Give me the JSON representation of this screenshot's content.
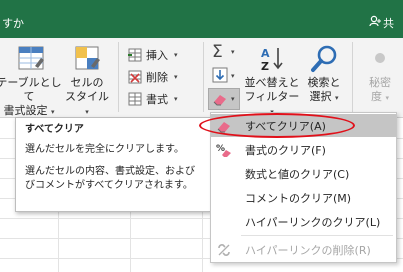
{
  "window": {
    "title_fragment": "すか",
    "share_label": "共"
  },
  "ribbon": {
    "table_button": {
      "line1": "テーブルとして",
      "line2": "書式設定"
    },
    "cell_style_button": {
      "line1": "セルの",
      "line2": "スタイル"
    },
    "cells_group": {
      "insert_label": "挿入",
      "delete_label": "削除",
      "format_label": "書式"
    },
    "sort_filter_button": {
      "line1": "並べ替えと",
      "line2": "フィルター"
    },
    "find_select_button": {
      "line1": "検索と",
      "line2": "選択"
    },
    "sensitivity_button": {
      "line1": "秘密",
      "line2": "度"
    }
  },
  "tooltip": {
    "title": "すべてクリア",
    "line1": "選んだセルを完全にクリアします。",
    "line2": "選んだセルの内容、書式設定、および",
    "line3": "びコメントがすべてクリアされます。"
  },
  "clear_menu": {
    "items": [
      {
        "label": "すべてクリア(A)",
        "icon": "eraser-icon"
      },
      {
        "label": "書式のクリア(F)",
        "icon": "percent-eraser-icon"
      },
      {
        "label": "数式と値のクリア(C)",
        "icon": ""
      },
      {
        "label": "コメントのクリア(M)",
        "icon": ""
      },
      {
        "label": "ハイパーリンクのクリア(L)",
        "icon": ""
      },
      {
        "label": "ハイパーリンクの削除(R)",
        "icon": "unlink-icon"
      }
    ]
  },
  "colors": {
    "titlebar": "#217346",
    "highlight": "#c5c5c5",
    "annotation": "#e0101a"
  }
}
